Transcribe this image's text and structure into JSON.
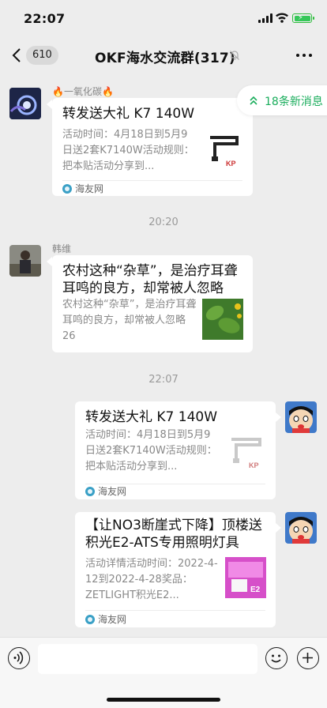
{
  "status": {
    "time": "22:07"
  },
  "nav": {
    "back_count": "610",
    "title": "OKF海水交流群(317)"
  },
  "new_messages": "18条新消息",
  "messages": [
    {
      "sender": "🔥一氧化碳🔥",
      "title": "转发送大礼 K7 140W",
      "desc": "活动时间：4月18日到5月9日送2套K7140W活动规则：把本贴活动分享到...",
      "source": "海友网"
    },
    {
      "sender": "韩维",
      "title": "农村这种“杂草”，是治疗耳聋耳鸣的良方，却常被人忽略",
      "desc": "农村这种“杂草”，是治疗耳聋耳鸣的良方，却常被人忽略 26"
    },
    {
      "title": "转发送大礼 K7 140W",
      "desc": "活动时间：4月18日到5月9日送2套K7140W活动规则：把本贴活动分享到...",
      "source": "海友网"
    },
    {
      "title": "【让NO3断崖式下降】顶楼送积光E2-ATS专用照明灯具",
      "desc": "活动详情活动时间：2022-4-12到2022-4-28奖品：ZETLIGHT积光E2...",
      "source": "海友网"
    }
  ],
  "timestamps": [
    "20:20",
    "22:07"
  ],
  "thumb_texts": {
    "kp": "KP",
    "e2": "E2"
  }
}
